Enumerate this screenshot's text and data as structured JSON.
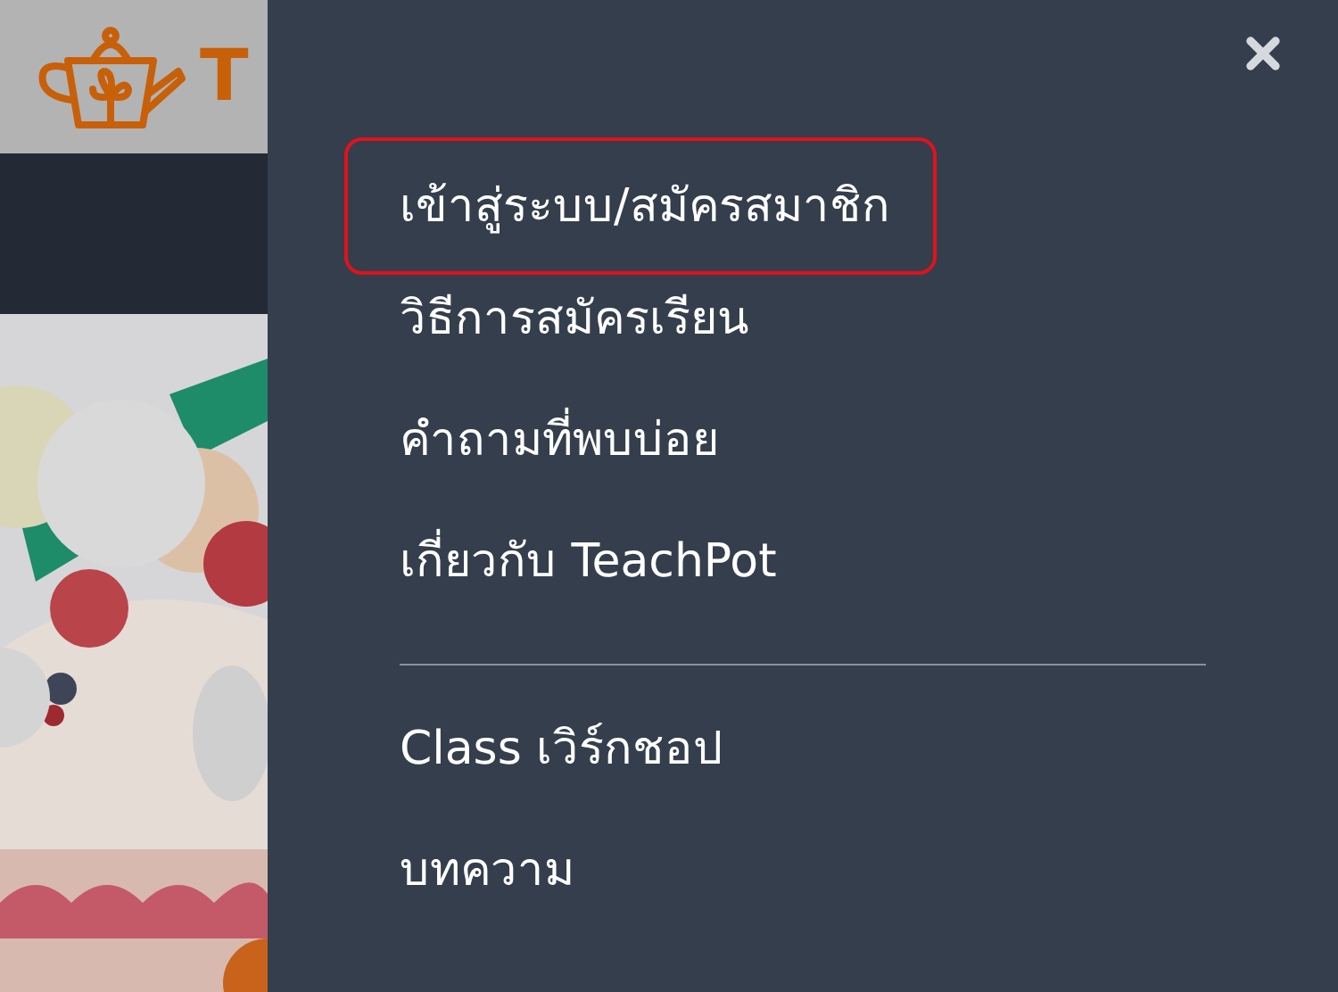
{
  "background_page": {
    "logo_text": "T"
  },
  "menu": {
    "groups": [
      {
        "items": [
          {
            "label": "เข้าสู่ระบบ/สมัครสมาชิก",
            "highlighted": true
          },
          {
            "label": "วิธีการสมัครเรียน",
            "highlighted": false
          },
          {
            "label": "คำถามที่พบบ่อย",
            "highlighted": false
          },
          {
            "label": "เกี่ยวกับ TeachPot",
            "highlighted": false
          }
        ]
      },
      {
        "items": [
          {
            "label": "Class เวิร์กชอป",
            "highlighted": false
          },
          {
            "label": "บทความ",
            "highlighted": false
          }
        ]
      }
    ]
  }
}
